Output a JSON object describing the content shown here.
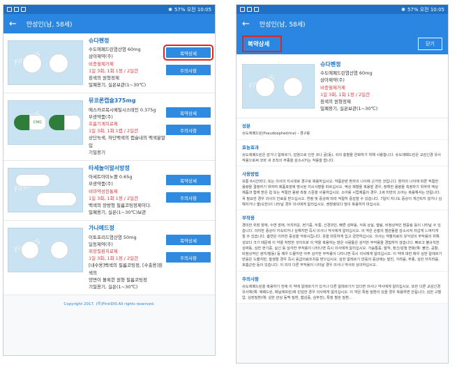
{
  "status_bar": {
    "right_text": "57% 오전 10:05"
  },
  "list_screen": {
    "title": "만성인(남, 58세)",
    "drugs": [
      {
        "name": "슈다펜정",
        "lines": [
          "수도에페드린염산염 60mg",
          "삼아제약(주)"
        ],
        "red_lines": [
          "비충혈제거제",
          "1일 3회, 1회 1정 / 2일간"
        ],
        "extra_lines": [
          "흰색의 원형정제",
          "밀폐용기, 실온보관(1~30℃)"
        ],
        "buttons": [
          "복약상세",
          "주의사항"
        ]
      },
      {
        "name": "뮤코론캡슐375mg",
        "lines": [
          "에스카르복시메틸시스테인 0.375g",
          "부광약품(주)"
        ],
        "red_lines": [
          "호흡기계치료제",
          "1일 3회, 1회 1캡 / 2일간"
        ],
        "extra_lines": [
          "상단녹색, 하단백색의 캡슐내의 백색분말입",
          "기밀용기"
        ],
        "capsule_text": "CMC",
        "buttons": [
          "복약상세",
          "주의사항"
        ]
      },
      {
        "name": "타세놀이알서방정",
        "lines": [
          "아세트아미노펜 0.65g",
          "부광약품(주)"
        ],
        "red_lines": [
          "비마약성진통제",
          "1일 3회, 1회 1정 / 2일간"
        ],
        "extra_lines": [
          "백색의 장방형 필름코팅정제이다.",
          "밀폐용기, 실온(1~30℃)보관"
        ],
        "buttons": [
          "복약상세",
          "주의사항"
        ]
      },
      {
        "name": "가나메드정",
        "lines": [
          "이토프리드염산염 50mg",
          "일동제약(주)"
        ],
        "red_lines": [
          "위장질환치료제",
          "1일 3회, 1회 1정 / 2일간"
        ],
        "extra_lines": [
          "[내수용]백색의 필름코팅정, [수출용]흰색의",
          "양면이 볼록한 원형 필름코팅정",
          "기밀용기, 실온(1~30℃)"
        ],
        "buttons": [
          "복약상세",
          "주의사항"
        ]
      }
    ],
    "copyright": "Copyright 2017. (주)FirstDIS All rights reserved."
  },
  "detail_screen": {
    "title": "만성인(남, 58세)",
    "header": "복약상세",
    "close_label": "닫기",
    "drug": {
      "name": "슈다펜정",
      "lines": [
        "수도에페드린염산염 60mg",
        "삼아제약(주)"
      ],
      "red_lines": [
        "비충혈제거제",
        "1일 3회, 1회 1정 / 2일간"
      ],
      "extra_lines": [
        "흰색의 원형정제",
        "밀폐용기, 실온보관(1~30℃)"
      ]
    },
    "sections": [
      {
        "heading": "성분",
        "body": "슈도에페드린(Pseudoephedrine) - 경구용"
      },
      {
        "heading": "효능효과",
        "body": "슈도에페드린은 감기나 알레르기, 감염으로 인한 코나 굴(동), 귀의 충혈을 완화하기 위해 사용합니다. 슈도에페드린은 교감신경 유사작용으로써 코와 귀 조직의 부종을 감소시키는 작용을 합니다."
      },
      {
        "heading": "사용방법",
        "body": "보통 6시간마다, 또는 의사의 지시대로 경구로 복용하십시오. 약품관련 환자의 나이에 근거한 것입니다. 환자의 나이에 따른 적절한 용량을 결정하기 위하여 제품포장에 명시된 지시사항을 따르십시오. 액상 제형을 복용할 경우, 정확한 용량을 측정하기 위하여 액상 제품과 함께 받은 컵 또는 적절한 용량 측정 스푼을 사용하십시오. 소아용 시럽제품의 경우, 2세 미만의 소아는 복용해서는 안됩니다. 꼭 필요한 경우 의사의 진료를 받으십시오. 연령 및 증상에 따라 적절히 증감할 수 있습니다. 7일이 지나도 증상이 개선되지 않거나 심해지거나 열(오한)이 나타날 경우 의사에게 알리십시오. 권장량보다 많이 복용하지 마십시오."
      },
      {
        "heading": "부작용",
        "body": "경미한 위장 장애, 수면 장애, 어지러운, 현기증, 두통, 신경과민, 빠른 심박동, 식욕 상실, 떨림, 비정상적인 땀흘림 등이 나타날 수 있습니다. 이러한 증상이 지속되거나 심해지면 즉시 의사나 약사에게 알리십시오. 이 약은 손발의 혈관들을 감소시켜 차갑게 느껴지게 할 수 있습니다. 흡연은 이러한 증상을 악화시킵니다. 옷을 따뜻하게 입고 금연하십시오. 의사는 약물치료의 유익성이 부작용의 위해성보다 크기 때문에 이 약을 처방한 것이므로 이 약을 복용하는 많은 사람들은 심각한 부작용을 경험하지 않습니다. 빠르고 불규칙한 심박동, 심한 현기증, 실신 등 심각한 부작용이 나타나면 즉시 의사에게 알리십시오. 가슴통증, 발작, 정신/감정 변화(예: 불안, 공황, 비정상적인 생각/행동) 등 매우 드물지만 아주 심각한 부작용이 나타나면 즉시 의사에게 알리십시오. 이 약에 대한 매우 심한 알레르기 반응은 드물지만, 발생할 경우 즉시 응급의료조치를 받으십시오. 심한 알레르기 반응의 증상에는 발진, 가려움, 부종, 심한 어지러움, 호흡곤란 등이 있습니다. 이 외의 다른 부작용이 나타날 경우 의사나 약사와 상의하십시오."
      },
      {
        "heading": "주의사항",
        "body": "슈도에페드린을 복용하기 전에 이 약에 알레르기가 있거나 다른 알레르기가 있다면 의사나 약사에게 알리십시오. 또한 다른 교감신경유사제(예: 에페드린, 페닐에프린)에 민감한 경우 의사에게 알리십시오. 이 약은 특정 질환이 있을 경우 복용하면 안됩니다. 심한 고혈압, 심장질환(예: 심한 관상 동맥 질환, 협심증, 심부전), 특정 혈관 질환..."
      }
    ]
  }
}
